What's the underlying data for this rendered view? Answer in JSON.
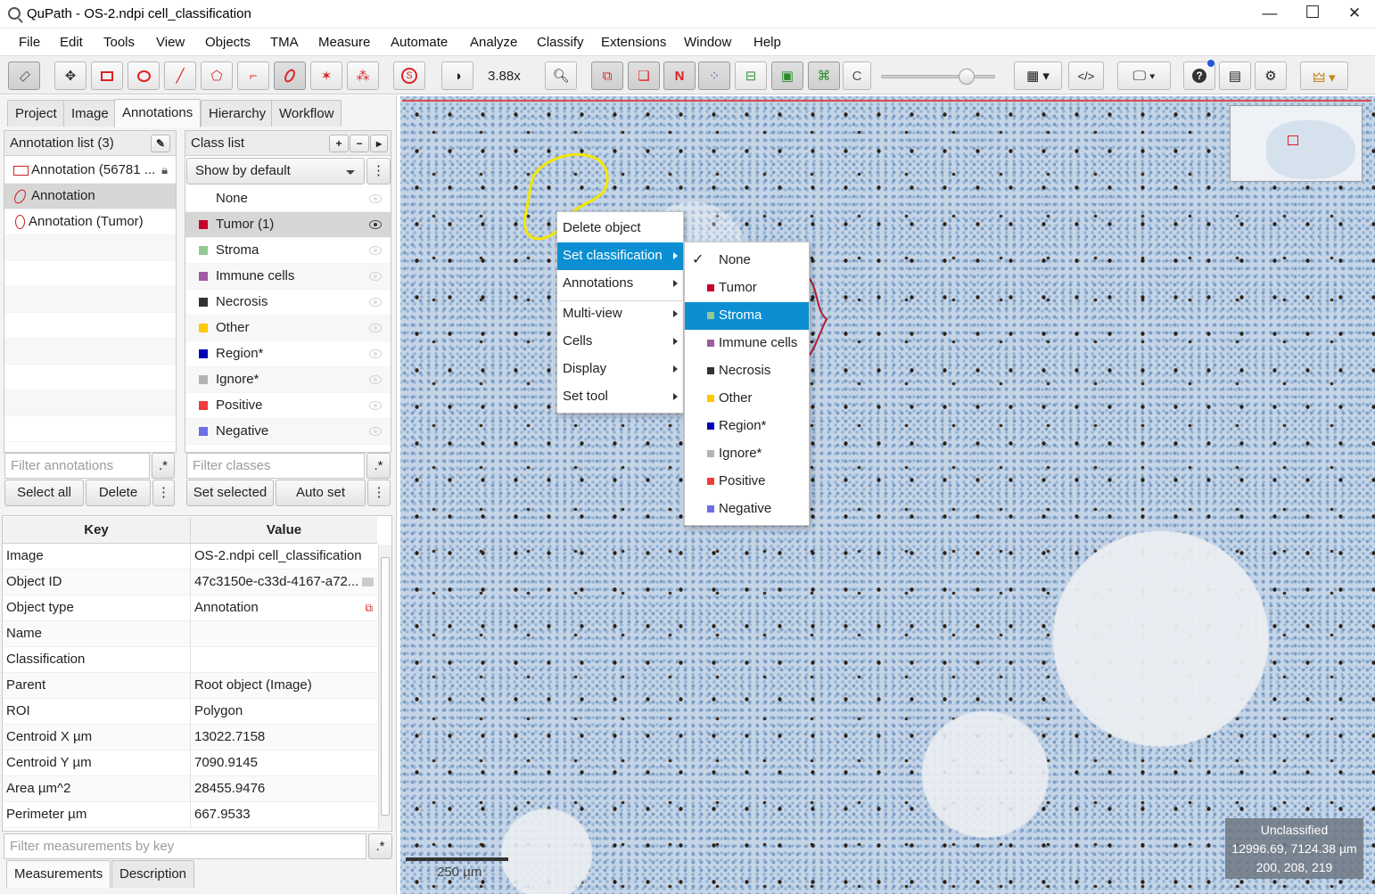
{
  "window": {
    "title": "QuPath - OS-2.ndpi cell_classification",
    "minimize": "—",
    "maximize": "☐",
    "close": "✕"
  },
  "menu": [
    "File",
    "Edit",
    "Tools",
    "View",
    "Objects",
    "TMA",
    "Measure",
    "Automate",
    "Analyze",
    "Classify",
    "Extensions",
    "Window",
    "Help"
  ],
  "toolbar": {
    "zoom": "3.88x",
    "n_label": "N",
    "c_label": "C"
  },
  "tabs": [
    "Project",
    "Image",
    "Annotations",
    "Hierarchy",
    "Workflow"
  ],
  "annotation_list": {
    "header": "Annotation list (3)",
    "items": [
      "Annotation (56781 ...",
      "Annotation",
      "Annotation (Tumor)"
    ],
    "filter_placeholder": "Filter annotations",
    "select_all": "Select all",
    "delete": "Delete"
  },
  "class_list": {
    "header": "Class list",
    "show_by_default": "Show by default",
    "items": [
      {
        "name": "None",
        "color": ""
      },
      {
        "name": "Tumor (1)",
        "color": "#c8002a"
      },
      {
        "name": "Stroma",
        "color": "#96c896"
      },
      {
        "name": "Immune cells",
        "color": "#a05aa0"
      },
      {
        "name": "Necrosis",
        "color": "#323232"
      },
      {
        "name": "Other",
        "color": "#ffc800"
      },
      {
        "name": "Region*",
        "color": "#0000b4"
      },
      {
        "name": "Ignore*",
        "color": "#b4b4b4"
      },
      {
        "name": "Positive",
        "color": "#ef3c3c"
      },
      {
        "name": "Negative",
        "color": "#6e6ee6"
      }
    ],
    "filter_placeholder": "Filter classes",
    "set_selected": "Set selected",
    "auto_set": "Auto set",
    "regex": ".*"
  },
  "measurements": {
    "key_header": "Key",
    "value_header": "Value",
    "rows": [
      {
        "k": "Image",
        "v": "OS-2.ndpi cell_classification"
      },
      {
        "k": "Object ID",
        "v": "47c3150e-c33d-4167-a72..."
      },
      {
        "k": "Object type",
        "v": "Annotation"
      },
      {
        "k": "Name",
        "v": ""
      },
      {
        "k": "Classification",
        "v": ""
      },
      {
        "k": "Parent",
        "v": "Root object (Image)"
      },
      {
        "k": "ROI",
        "v": "Polygon"
      },
      {
        "k": "Centroid X µm",
        "v": "13022.7158"
      },
      {
        "k": "Centroid Y µm",
        "v": "7090.9145"
      },
      {
        "k": "Area µm^2",
        "v": "28455.9476"
      },
      {
        "k": "Perimeter µm",
        "v": "667.9533"
      }
    ],
    "filter_placeholder": "Filter measurements by key",
    "tab_measurements": "Measurements",
    "tab_description": "Description"
  },
  "context_menu": {
    "items": [
      "Delete object",
      "Set classification",
      "Annotations",
      "Multi-view",
      "Cells",
      "Display",
      "Set tool"
    ],
    "submenu": [
      {
        "name": "None",
        "color": ""
      },
      {
        "name": "Tumor",
        "color": "#c8002a"
      },
      {
        "name": "Stroma",
        "color": "#96c896"
      },
      {
        "name": "Immune cells",
        "color": "#a05aa0"
      },
      {
        "name": "Necrosis",
        "color": "#323232"
      },
      {
        "name": "Other",
        "color": "#ffc800"
      },
      {
        "name": "Region*",
        "color": "#0000b4"
      },
      {
        "name": "Ignore*",
        "color": "#b4b4b4"
      },
      {
        "name": "Positive",
        "color": "#ef3c3c"
      },
      {
        "name": "Negative",
        "color": "#6e6ee6"
      }
    ],
    "check": "✓"
  },
  "viewer_info": {
    "line1": "Unclassified",
    "line2": "12996.69, 7124.38 µm",
    "line3": "200, 208, 219"
  },
  "scalebar": "250 µm"
}
